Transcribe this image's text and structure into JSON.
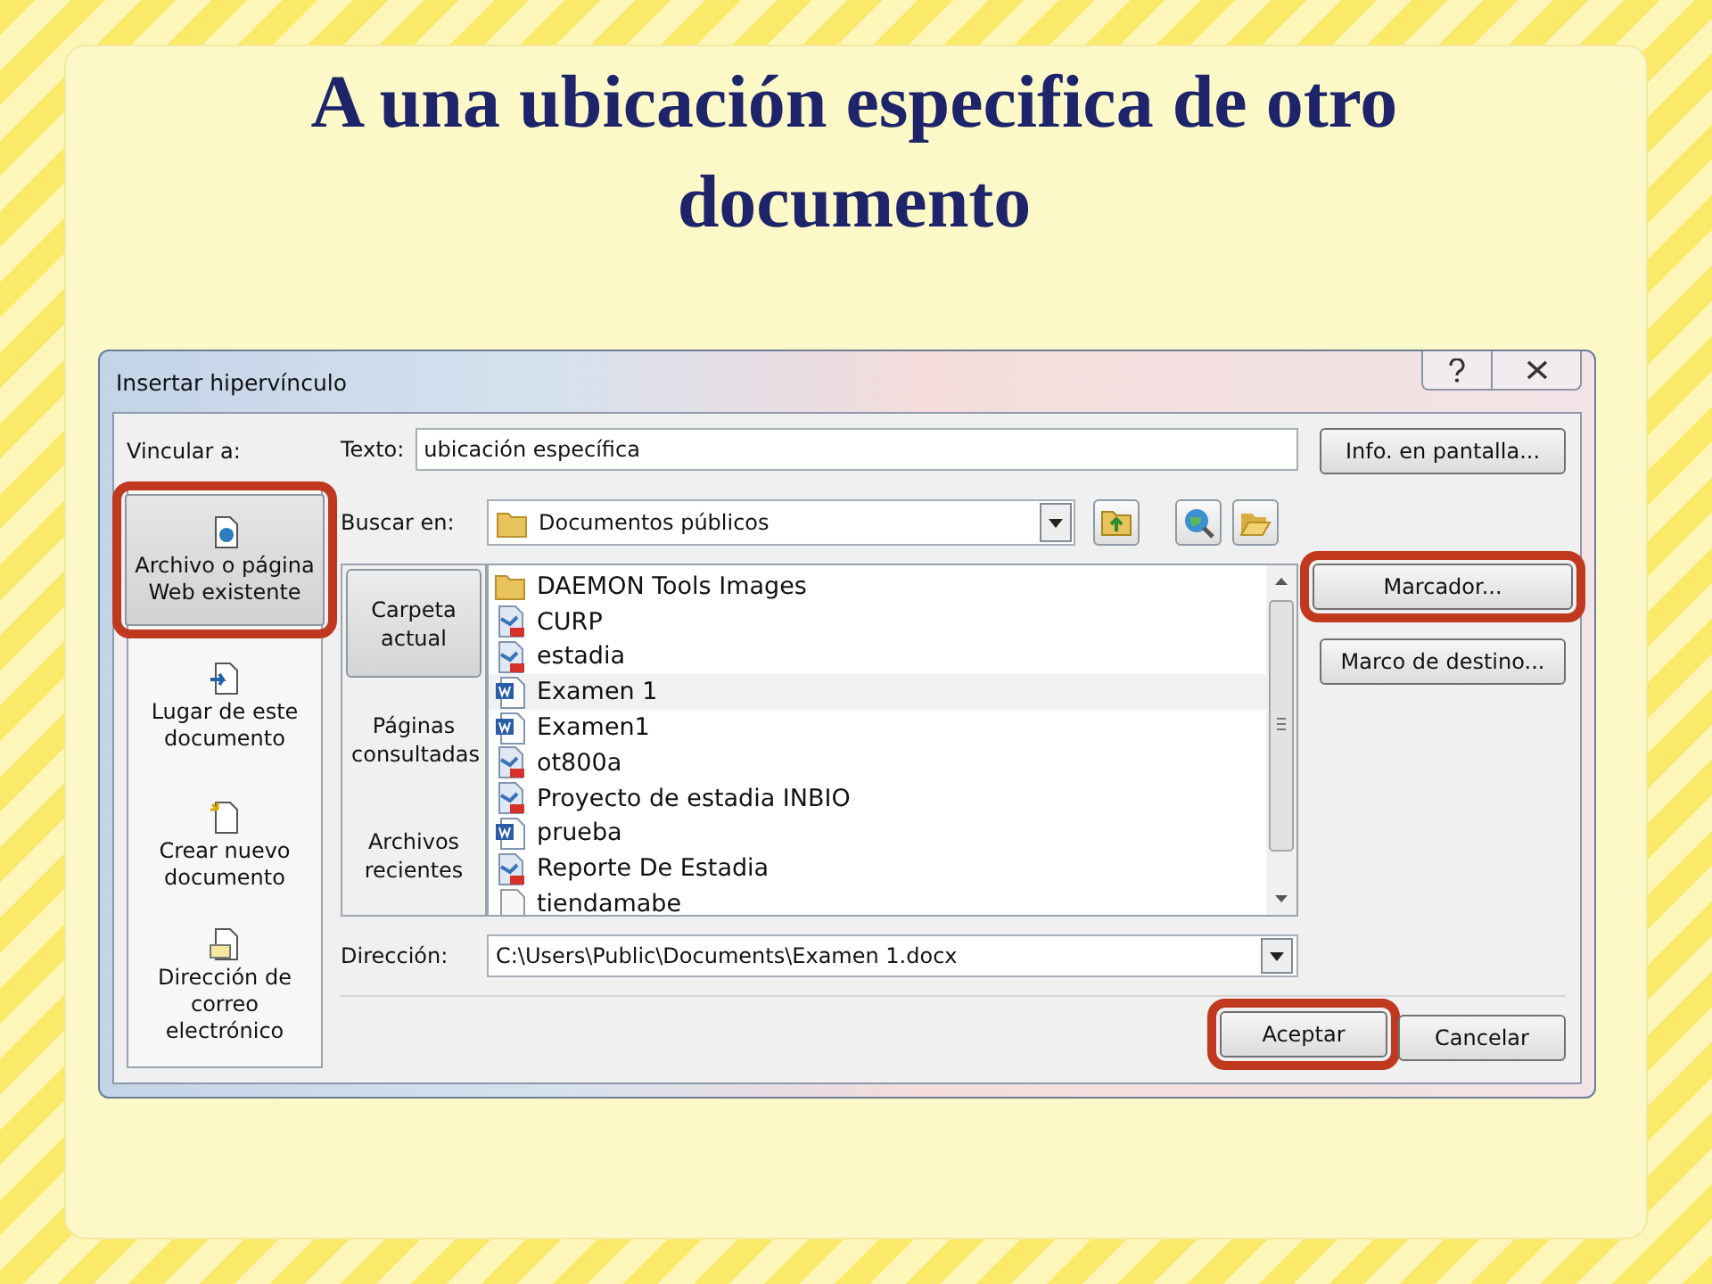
{
  "slide": {
    "title": "A una ubicación especifica de otro documento"
  },
  "dialog": {
    "title": "Insertar hipervínculo",
    "link_to_label": "Vincular a:",
    "link_targets": [
      {
        "label": "Archivo o página Web existente",
        "kind": "web",
        "selected": true,
        "highlighted": true
      },
      {
        "label": "Lugar de este documento",
        "kind": "place",
        "selected": false,
        "highlighted": false
      },
      {
        "label": "Crear nuevo documento",
        "kind": "new",
        "selected": false,
        "highlighted": false
      },
      {
        "label": "Dirección de correo electrónico",
        "kind": "mail",
        "selected": false,
        "highlighted": false
      }
    ],
    "text_label": "Texto:",
    "text_value": "ubicación específica",
    "screen_tip_button": "Info. en pantalla...",
    "look_in_label": "Buscar en:",
    "look_in_value": "Documentos públicos",
    "side_tabs": [
      {
        "label": "Carpeta actual",
        "selected": true
      },
      {
        "label": "Páginas consultadas",
        "selected": false
      },
      {
        "label": "Archivos recientes",
        "selected": false
      }
    ],
    "files": [
      {
        "name": "DAEMON Tools Images",
        "kind": "folder",
        "selected": false
      },
      {
        "name": "CURP",
        "kind": "pdf",
        "selected": false
      },
      {
        "name": "estadia",
        "kind": "pdf",
        "selected": false
      },
      {
        "name": "Examen 1",
        "kind": "word",
        "selected": true
      },
      {
        "name": "Examen1",
        "kind": "word",
        "selected": false
      },
      {
        "name": "ot800a",
        "kind": "pdf",
        "selected": false
      },
      {
        "name": "Proyecto de estadia INBIO",
        "kind": "pdf",
        "selected": false
      },
      {
        "name": "prueba",
        "kind": "word",
        "selected": false
      },
      {
        "name": "Reporte De Estadia",
        "kind": "pdf",
        "selected": false
      },
      {
        "name": "tiendamabe",
        "kind": "blank",
        "selected": false
      }
    ],
    "address_label": "Dirección:",
    "address_value": "C:\\Users\\Public\\Documents\\Examen 1.docx",
    "side_buttons": [
      {
        "label": "Marcador...",
        "highlighted": true
      },
      {
        "label": "Marco de destino...",
        "highlighted": false
      }
    ],
    "footer_buttons": [
      {
        "label": "Aceptar",
        "highlighted": true
      },
      {
        "label": "Cancelar",
        "highlighted": false
      }
    ]
  }
}
